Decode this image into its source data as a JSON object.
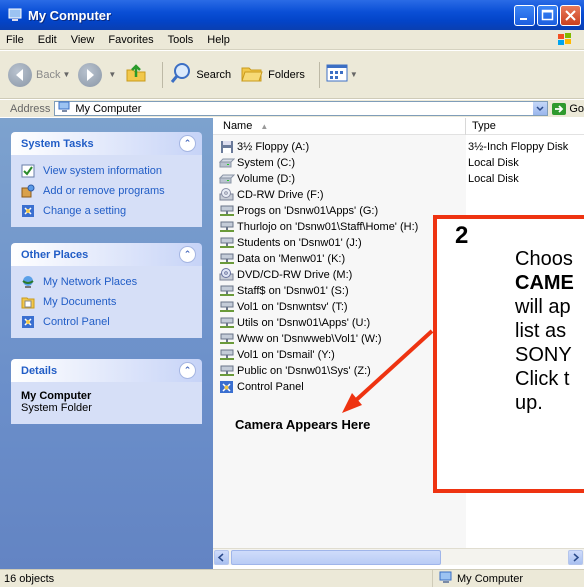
{
  "window": {
    "title": "My Computer",
    "controls": {
      "minimize": "minimize",
      "maximize": "maximize",
      "close": "close"
    }
  },
  "menu": [
    "File",
    "Edit",
    "View",
    "Favorites",
    "Tools",
    "Help"
  ],
  "toolbar": {
    "back": "Back",
    "search": "Search",
    "folders": "Folders"
  },
  "address": {
    "label": "Address",
    "value": "My Computer",
    "go": "Go"
  },
  "tasks": {
    "system_tasks": {
      "title": "System Tasks",
      "items": [
        "View system information",
        "Add or remove programs",
        "Change a setting"
      ]
    },
    "other_places": {
      "title": "Other Places",
      "items": [
        "My Network Places",
        "My Documents",
        "Control Panel"
      ]
    },
    "details": {
      "title": "Details",
      "name": "My Computer",
      "sub": "System Folder"
    }
  },
  "columns": {
    "name": "Name",
    "type": "Type"
  },
  "items": [
    {
      "name": "3½ Floppy (A:)",
      "type": "3½-Inch Floppy Disk",
      "icon": "floppy-icon"
    },
    {
      "name": "System (C:)",
      "type": "Local Disk",
      "icon": "disk-icon"
    },
    {
      "name": "Volume (D:)",
      "type": "Local Disk",
      "icon": "disk-icon"
    },
    {
      "name": "CD-RW Drive (F:)",
      "type": "",
      "icon": "cd-icon"
    },
    {
      "name": "Progs on 'Dsnw01\\Apps' (G:)",
      "type": "",
      "icon": "network-drive-icon"
    },
    {
      "name": "Thurlojo on 'Dsnw01\\Staff\\Home' (H:)",
      "type": "",
      "icon": "network-drive-icon"
    },
    {
      "name": "Students on 'Dsnw01' (J:)",
      "type": "",
      "icon": "network-drive-icon"
    },
    {
      "name": "Data on 'Menw01' (K:)",
      "type": "",
      "icon": "network-drive-icon"
    },
    {
      "name": "DVD/CD-RW Drive (M:)",
      "type": "",
      "icon": "dvd-icon"
    },
    {
      "name": "Staff$ on 'Dsnw01' (S:)",
      "type": "",
      "icon": "network-drive-icon"
    },
    {
      "name": "Vol1 on 'Dsnwntsv' (T:)",
      "type": "",
      "icon": "network-drive-icon"
    },
    {
      "name": "Utils on 'Dsnw01\\Apps' (U:)",
      "type": "",
      "icon": "network-drive-icon"
    },
    {
      "name": "Www on 'Dsnwweb\\Vol1' (W:)",
      "type": "",
      "icon": "network-drive-icon"
    },
    {
      "name": "Vol1 on 'Dsmail' (Y:)",
      "type": "",
      "icon": "network-drive-icon"
    },
    {
      "name": "Public on 'Dsnw01\\Sys' (Z:)",
      "type": "",
      "icon": "network-drive-icon"
    },
    {
      "name": "Control Panel",
      "type": "",
      "icon": "control-panel-icon"
    }
  ],
  "camera_note": "Camera Appears Here",
  "callout": {
    "number": "2",
    "lines": [
      "Choos",
      "CAME",
      "will ap",
      "list as",
      "SONY",
      "Click t",
      "up."
    ],
    "color": "#ee3311"
  },
  "status": {
    "left": "16 objects",
    "right": "My Computer"
  }
}
